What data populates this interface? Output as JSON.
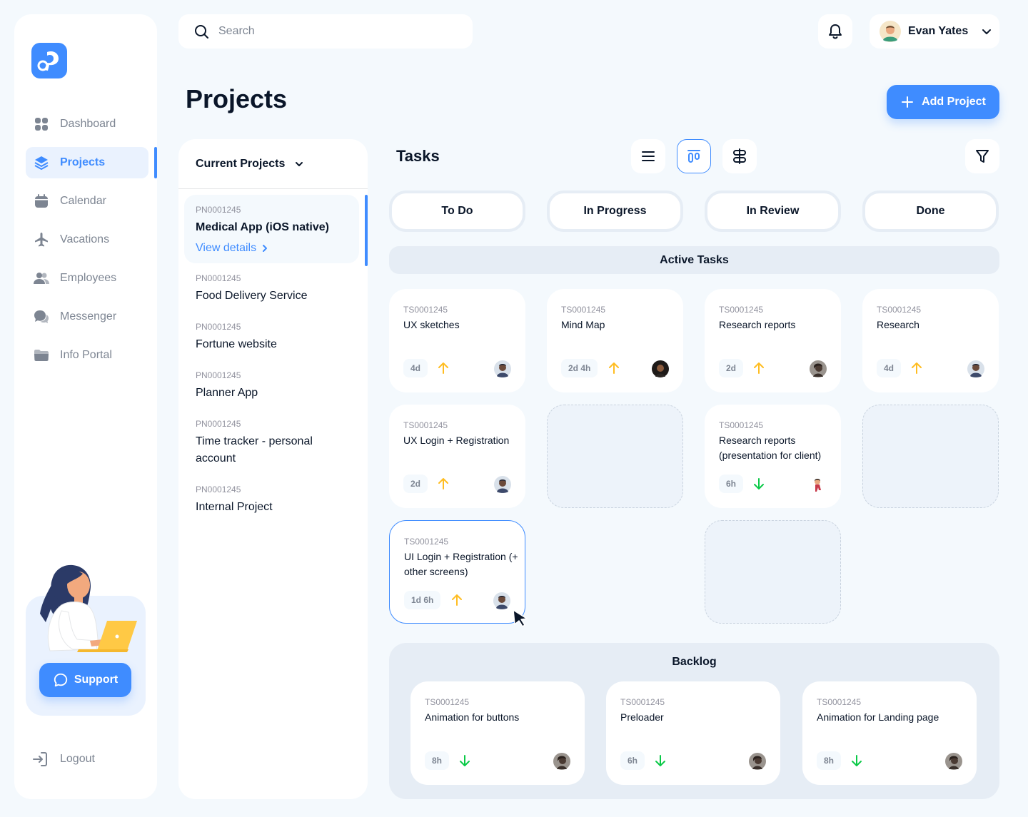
{
  "sidebar": {
    "items": [
      {
        "label": "Dashboard"
      },
      {
        "label": "Projects"
      },
      {
        "label": "Calendar"
      },
      {
        "label": "Vacations"
      },
      {
        "label": "Employees"
      },
      {
        "label": "Messenger"
      },
      {
        "label": "Info Portal"
      }
    ],
    "support_label": "Support",
    "logout_label": "Logout"
  },
  "header": {
    "search_placeholder": "Search",
    "user_name": "Evan Yates"
  },
  "page": {
    "title": "Projects",
    "add_button": "Add Project"
  },
  "projects": {
    "header": "Current Projects",
    "view_details": "View details",
    "items": [
      {
        "code": "PN0001245",
        "name": "Medical App (iOS native)"
      },
      {
        "code": "PN0001245",
        "name": "Food Delivery Service"
      },
      {
        "code": "PN0001245",
        "name": "Fortune website"
      },
      {
        "code": "PN0001245",
        "name": "Planner App"
      },
      {
        "code": "PN0001245",
        "name": "Time tracker - personal account"
      },
      {
        "code": "PN0001245",
        "name": "Internal Project"
      }
    ]
  },
  "tasks": {
    "title": "Tasks",
    "columns": [
      "To Do",
      "In Progress",
      "In Review",
      "Done"
    ],
    "active_label": "Active Tasks",
    "backlog_label": "Backlog",
    "cards": [
      {
        "code": "TS0001245",
        "name": "UX sketches",
        "time": "4d",
        "priority": "up"
      },
      {
        "code": "TS0001245",
        "name": "Mind Map",
        "time": "2d 4h",
        "priority": "up"
      },
      {
        "code": "TS0001245",
        "name": "Research reports",
        "time": "2d",
        "priority": "up"
      },
      {
        "code": "TS0001245",
        "name": "Research",
        "time": "4d",
        "priority": "up"
      },
      {
        "code": "TS0001245",
        "name": "UX Login + Registration",
        "time": "2d",
        "priority": "up"
      },
      {
        "code": "TS0001245",
        "name": "Research reports (presentation for client)",
        "time": "6h",
        "priority": "down"
      },
      {
        "code": "TS0001245",
        "name": "UI Login + Registration (+ other screens)",
        "time": "1d 6h",
        "priority": "up"
      }
    ],
    "backlog": [
      {
        "code": "TS0001245",
        "name": "Animation for buttons",
        "time": "8h",
        "priority": "down"
      },
      {
        "code": "TS0001245",
        "name": "Preloader",
        "time": "6h",
        "priority": "down"
      },
      {
        "code": "TS0001245",
        "name": "Animation for Landing page",
        "time": "8h",
        "priority": "down"
      }
    ]
  },
  "colors": {
    "accent": "#3F8CFF",
    "priority_up": "#FFBD21",
    "priority_down": "#0AC947",
    "text": "#0A1629",
    "muted": "#7D8592"
  }
}
